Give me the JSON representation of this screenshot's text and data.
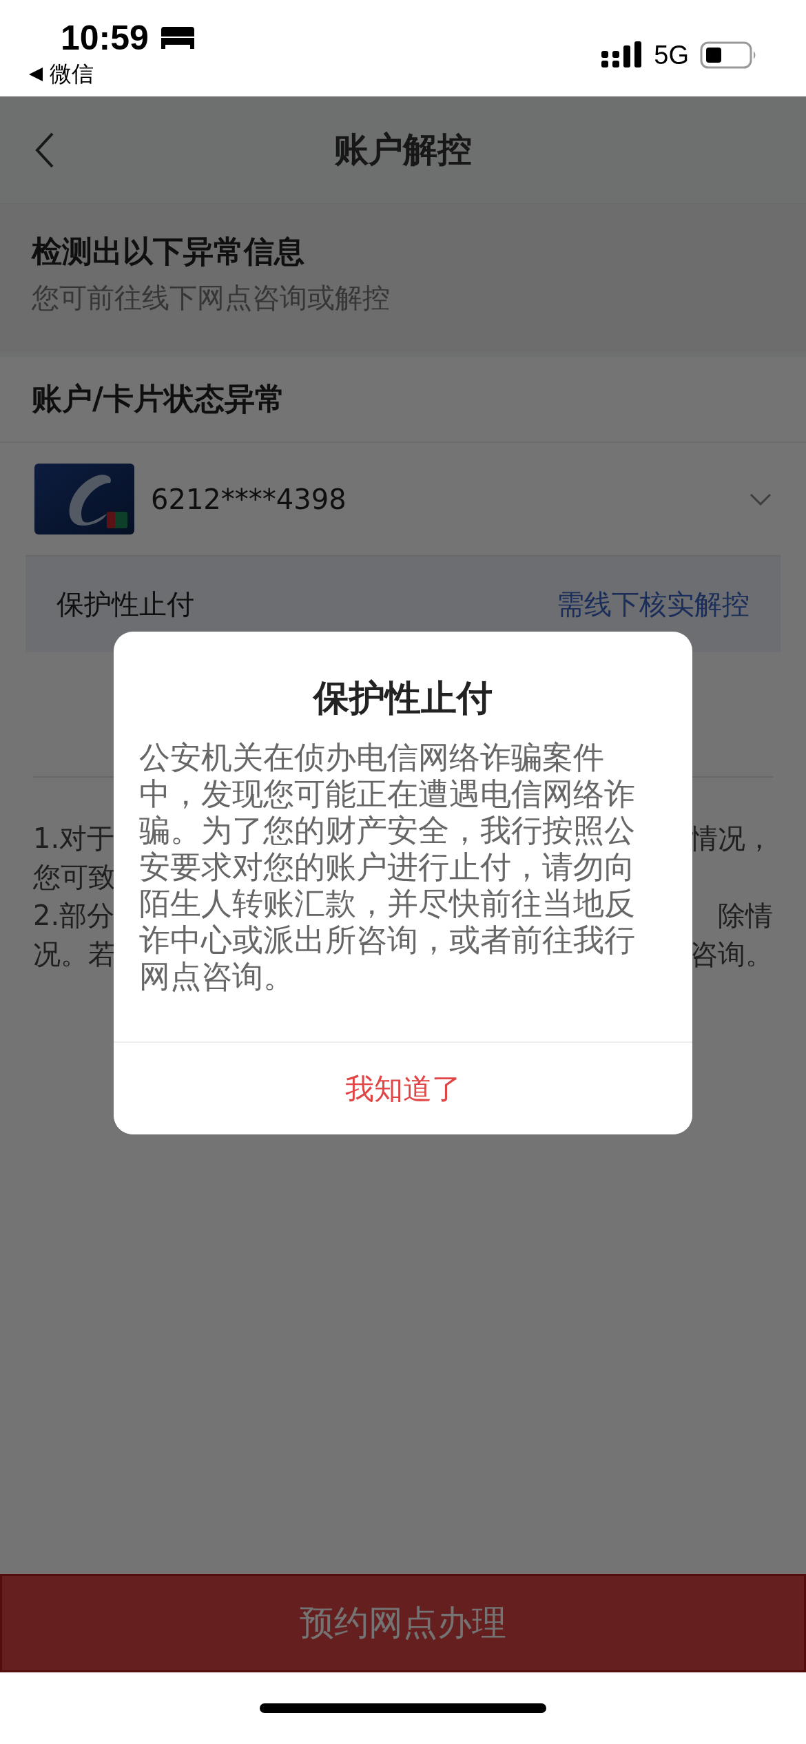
{
  "status_bar": {
    "time": "10:59",
    "back_app": "微信",
    "network": "5G"
  },
  "nav": {
    "title": "账户解控"
  },
  "notice": {
    "title": "检测出以下异常信息",
    "subtitle": "您可前往线下网点咨询或解控"
  },
  "section_title": "账户/卡片状态异常",
  "card": {
    "number": "6212****4398"
  },
  "status_row": {
    "label": "保护性止付",
    "action": "需线下核实解控"
  },
  "notes": [
    {
      "left": "1.对于",
      "right": "情况，"
    },
    {
      "left": "您可致"
    },
    {
      "left": "2.部分",
      "right": "除情"
    },
    {
      "left": "况。若",
      "right": "咨询。"
    }
  ],
  "primary_button": "预约网点办理",
  "dialog": {
    "title": "保护性止付",
    "body": "公安机关在侦办电信网络诈骗案件中，发现您可能正在遭遇电信网络诈骗。为了您的财产安全，我行按照公安要求对您的账户进行止付，请勿向陌生人转账汇款，并尽快前往当地反诈中心或派出所咨询，或者前往我行网点咨询。",
    "button": "我知道了"
  }
}
